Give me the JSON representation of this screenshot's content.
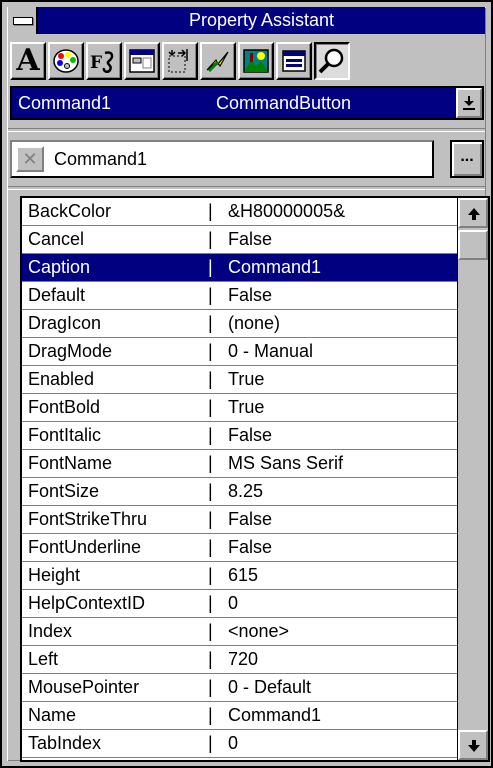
{
  "window": {
    "title": "Property Assistant"
  },
  "toolbar": {
    "tools": [
      {
        "icon": "font-a-icon",
        "label": "A"
      },
      {
        "icon": "color-palette-icon"
      },
      {
        "icon": "font-style-icon",
        "label": "F"
      },
      {
        "icon": "form-window-icon"
      },
      {
        "icon": "position-size-icon"
      },
      {
        "icon": "event-lightning-icon"
      },
      {
        "icon": "picture-icon"
      },
      {
        "icon": "list-grid-icon"
      },
      {
        "icon": "search-magnifier-icon",
        "pressed": true
      }
    ]
  },
  "object_combo": {
    "name": "Command1",
    "type": "CommandButton"
  },
  "edit": {
    "value": "Command1",
    "cancel_glyph": "✕",
    "ellipsis_label": "..."
  },
  "properties": [
    {
      "name": "BackColor",
      "value": "&H80000005&"
    },
    {
      "name": "Cancel",
      "value": "False"
    },
    {
      "name": "Caption",
      "value": "Command1",
      "selected": true
    },
    {
      "name": "Default",
      "value": "False"
    },
    {
      "name": "DragIcon",
      "value": "(none)"
    },
    {
      "name": "DragMode",
      "value": "0 - Manual"
    },
    {
      "name": "Enabled",
      "value": "True"
    },
    {
      "name": "FontBold",
      "value": "True"
    },
    {
      "name": "FontItalic",
      "value": "False"
    },
    {
      "name": "FontName",
      "value": "MS Sans Serif"
    },
    {
      "name": "FontSize",
      "value": "8.25"
    },
    {
      "name": "FontStrikeThru",
      "value": "False"
    },
    {
      "name": "FontUnderline",
      "value": "False"
    },
    {
      "name": "Height",
      "value": "615"
    },
    {
      "name": "HelpContextID",
      "value": "0"
    },
    {
      "name": "Index",
      "value": "<none>"
    },
    {
      "name": "Left",
      "value": "720"
    },
    {
      "name": "MousePointer",
      "value": "0 - Default"
    },
    {
      "name": "Name",
      "value": "Command1"
    },
    {
      "name": "TabIndex",
      "value": "0"
    }
  ],
  "separator_glyph": "|",
  "colors": {
    "title_bar": "#000080",
    "selection": "#000080",
    "face": "#c0c0c0"
  }
}
